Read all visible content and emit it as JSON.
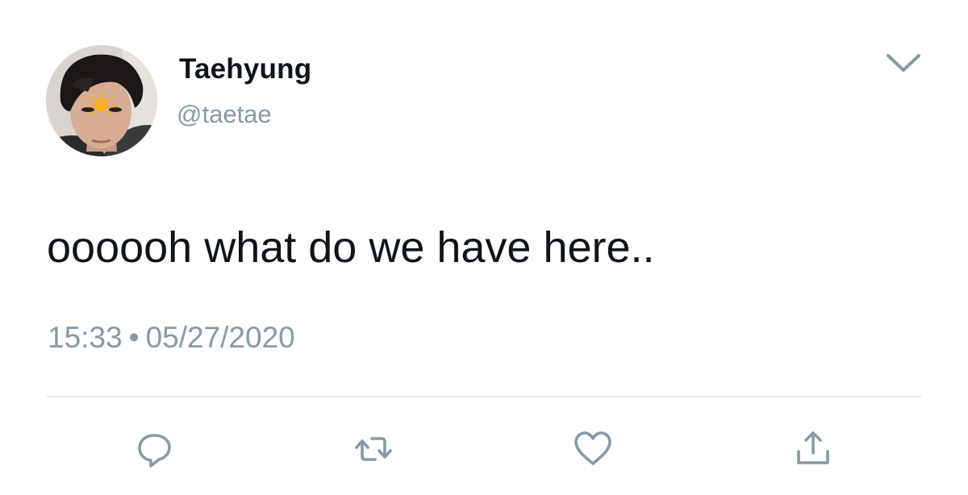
{
  "user": {
    "display_name": "Taehyung",
    "handle": "@taetae"
  },
  "tweet": {
    "text": "oooooh what do we have here..",
    "time": "15:33",
    "separator": "•",
    "date": "05/27/2020"
  },
  "actions": [
    {
      "name": "reply",
      "icon": "reply-icon"
    },
    {
      "name": "retweet",
      "icon": "retweet-icon"
    },
    {
      "name": "like",
      "icon": "heart-icon"
    },
    {
      "name": "share",
      "icon": "share-icon"
    }
  ],
  "colors": {
    "text": "#0f1419",
    "secondary": "#8899a6",
    "divider": "#d8dde2",
    "icon": "#8899a6"
  }
}
